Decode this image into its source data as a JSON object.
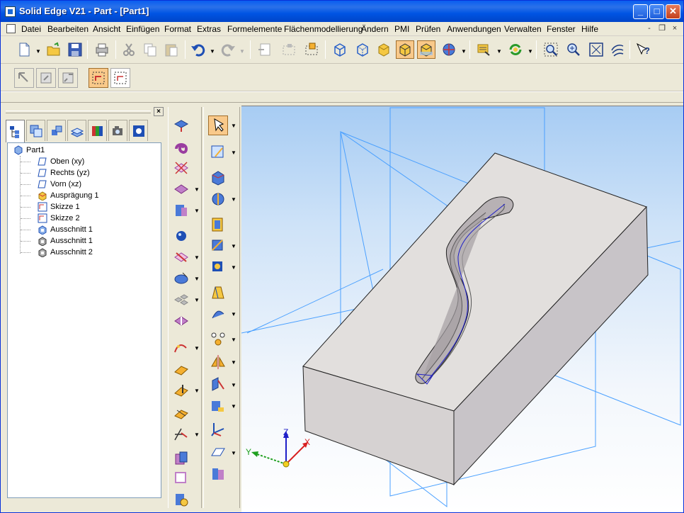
{
  "window": {
    "title": "Solid Edge V21 - Part - [Part1]",
    "controls": {
      "minimize": "_",
      "maximize": "□",
      "close": "✕"
    }
  },
  "menubar": {
    "items": [
      "Datei",
      "Bearbeiten",
      "Ansicht",
      "Einfügen",
      "Format",
      "Extras",
      "Formelemente",
      "Flächenmodellierung",
      "Ändern",
      "PMI",
      "Prüfen",
      "Anwendungen",
      "Verwalten",
      "Fenster",
      "Hilfe"
    ],
    "mdi_controls": [
      "-",
      "❐",
      "×"
    ]
  },
  "main_toolbar": {
    "buttons": [
      "new-icon",
      "open-icon",
      "save-icon",
      "print-icon",
      "cut-icon",
      "copy-icon",
      "paste-icon",
      "undo-icon",
      "redo-icon",
      "delete-icon",
      "capture-icon",
      "locate-icon",
      "view-iso-icon",
      "view-wire-icon",
      "view-shaded-icon",
      "view-shaded-edges-icon",
      "view-shaded-visible-icon",
      "sphere-icon",
      "property-icon",
      "refresh-icon",
      "zoom-area-icon",
      "zoom-icon",
      "fit-icon",
      "pan-icon",
      "help-icon"
    ]
  },
  "secondary_toolbar": {
    "buttons": [
      "select-feature-icon",
      "select-face-icon",
      "select-body-icon",
      "select-pattern-icon",
      "select-region-icon"
    ]
  },
  "pathfinder": {
    "close_label": "×",
    "tabs": [
      "tree-tab",
      "layers-tab",
      "assembly-tab",
      "features-tab",
      "colors-tab",
      "camera-tab",
      "settings-tab"
    ],
    "root": "Part1",
    "items": [
      {
        "label": "Oben (xy)",
        "icon": "plane-icon"
      },
      {
        "label": "Rechts (yz)",
        "icon": "plane-icon"
      },
      {
        "label": "Vorn (xz)",
        "icon": "plane-icon"
      },
      {
        "label": "Ausprägung 1",
        "icon": "protrusion-icon"
      },
      {
        "label": "Skizze 1",
        "icon": "sketch-icon"
      },
      {
        "label": "Skizze 2",
        "icon": "sketch-icon"
      },
      {
        "label": "Ausschnitt 1",
        "icon": "cutout-icon"
      },
      {
        "label": "Ausschnitt 1",
        "icon": "cutout-icon"
      },
      {
        "label": "Ausschnitt 2",
        "icon": "cutout-icon"
      }
    ]
  },
  "viewport": {
    "triad": {
      "x": "X",
      "y": "Y",
      "z": "Z"
    },
    "colors": {
      "background_top": "#a7ccf3",
      "block_top": "#e2dfdd",
      "block_front": "#d6d2d2",
      "block_side": "#c8c4c8",
      "plane_lines": "#4aa0ff"
    }
  }
}
